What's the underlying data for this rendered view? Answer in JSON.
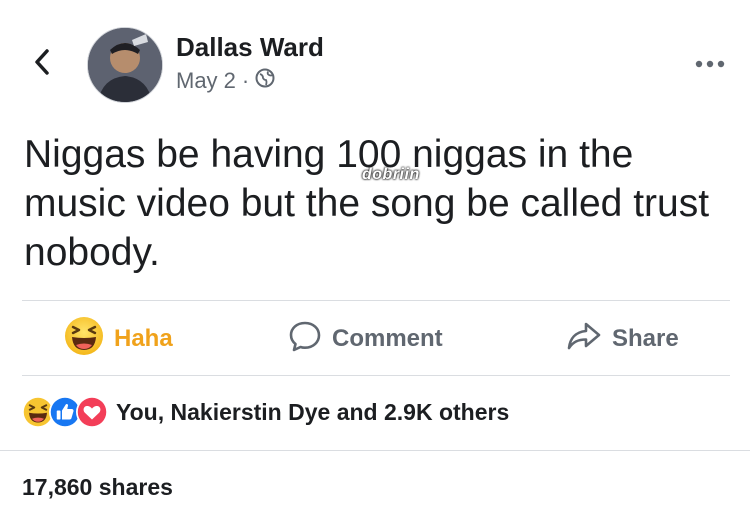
{
  "post": {
    "author": "Dallas Ward",
    "date": "May 2",
    "separator": "·",
    "privacy_icon": "globe-icon",
    "text": "Niggas be having 100 niggas in the music video but the song be called trust nobody.",
    "watermark": "dobriin"
  },
  "actions": {
    "haha_label": "Haha",
    "comment_label": "Comment",
    "share_label": "Share"
  },
  "reactions": {
    "icons": [
      "haha-icon",
      "like-icon",
      "love-icon"
    ],
    "summary": "You, Nakierstin Dye and 2.9K others"
  },
  "shares": {
    "label": "17,860 shares"
  },
  "colors": {
    "haha": "#f0a21b",
    "like": "#1877f2",
    "love": "#f33e58",
    "muted": "#606770",
    "text": "#1c1e21",
    "divider": "#dadde1"
  }
}
